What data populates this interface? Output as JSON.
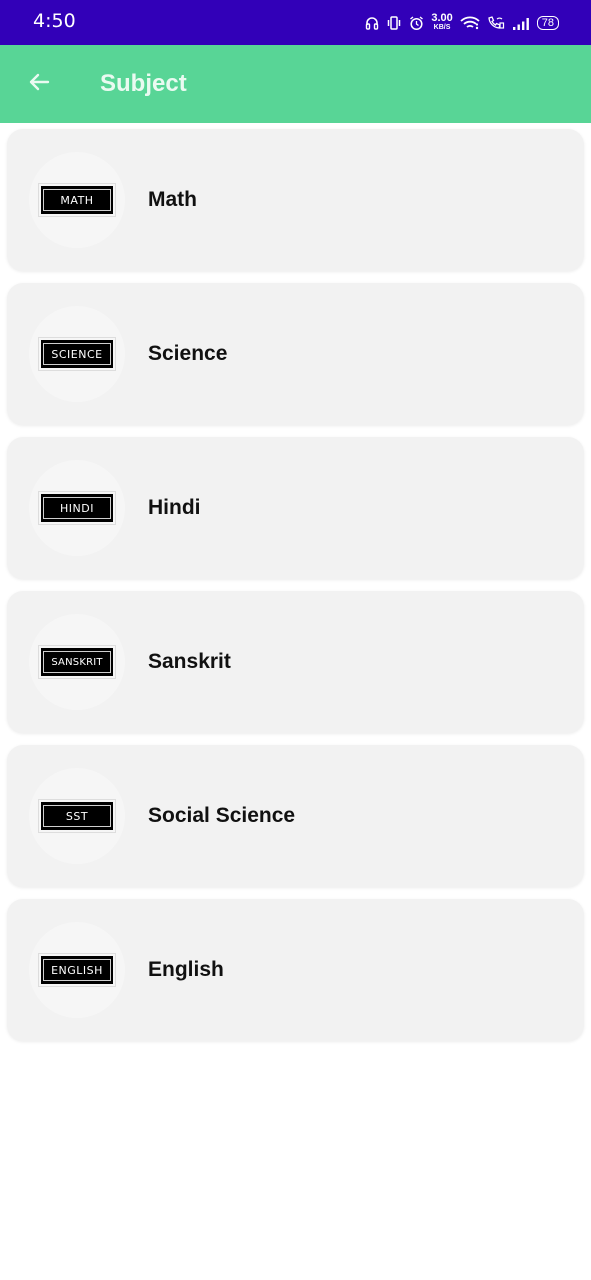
{
  "status_bar": {
    "time": "4:50",
    "network_speed_value": "3.00",
    "network_speed_unit": "KB/S",
    "battery": "78",
    "icons": [
      "headphones-icon",
      "vibrate-icon",
      "alarm-icon",
      "wifi-icon",
      "wifi-calling-icon",
      "signal-icon",
      "battery-icon"
    ]
  },
  "app_bar": {
    "title": "Subject",
    "back_icon": "arrow-left-icon",
    "color": "#58d596"
  },
  "colors": {
    "status_bar": "#3200b8",
    "card_background": "#f2f2f2"
  },
  "subjects": [
    {
      "badge": "MATH",
      "label": "Math"
    },
    {
      "badge": "SCIENCE",
      "label": "Science"
    },
    {
      "badge": "HINDI",
      "label": "Hindi"
    },
    {
      "badge": "SANSKRIT",
      "label": "Sanskrit"
    },
    {
      "badge": "SST",
      "label": "Social Science"
    },
    {
      "badge": "ENGLISH",
      "label": "English"
    }
  ]
}
